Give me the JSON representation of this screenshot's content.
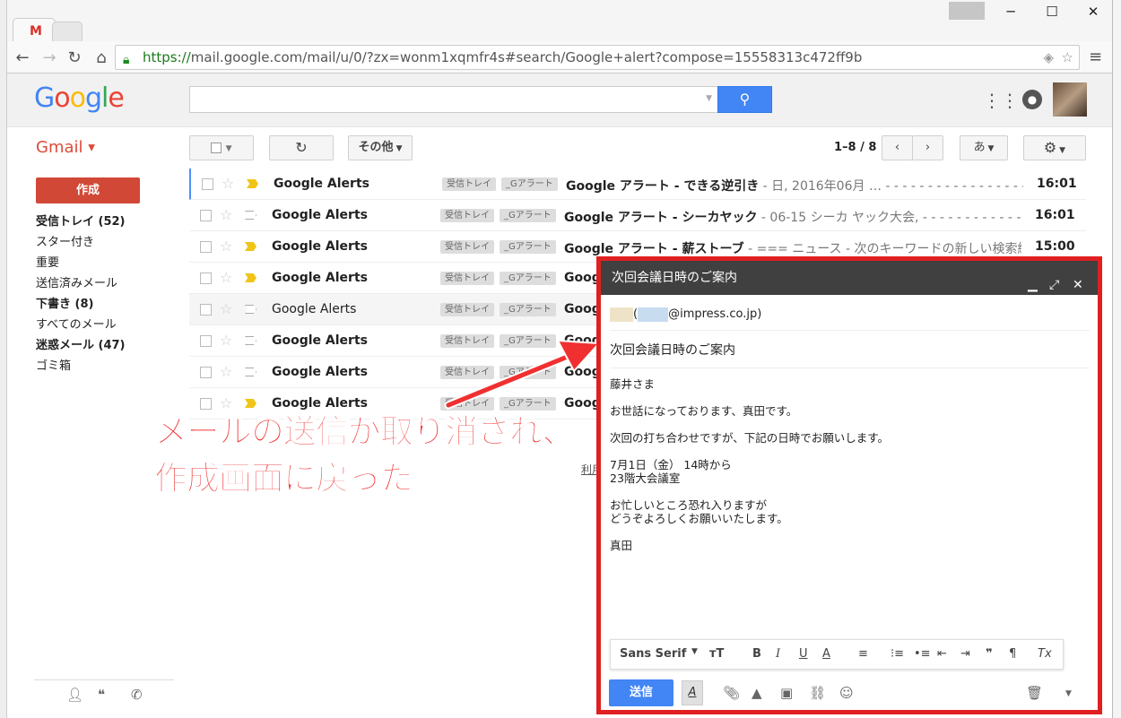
{
  "browser": {
    "tab_icon": "M",
    "url_scheme": "https://",
    "url_rest": "mail.google.com/mail/u/0/?zx=wonm1xqmfr4s#search/Google+alert?compose=15558313c472ff9b",
    "window_min": "─",
    "window_max": "☐",
    "window_close": "✕"
  },
  "header": {
    "logo_letters": [
      "G",
      "o",
      "o",
      "g",
      "l",
      "e"
    ],
    "logo_colors": [
      "#4285f4",
      "#ea4335",
      "#fbbc05",
      "#4285f4",
      "#34a853",
      "#ea4335"
    ],
    "search_placeholder": "",
    "search_icon": "search-icon"
  },
  "gmail": {
    "label": "Gmail",
    "compose_label": "作成",
    "more_label": "その他",
    "count_label": "1–8 / 8",
    "ime_label": "あ"
  },
  "nav": [
    {
      "label": "受信トレイ (52)",
      "bold": true
    },
    {
      "label": "スター付き",
      "bold": false
    },
    {
      "label": "重要",
      "bold": false
    },
    {
      "label": "送信済みメール",
      "bold": false
    },
    {
      "label": "下書き (8)",
      "bold": true
    },
    {
      "label": "すべてのメール",
      "bold": false
    },
    {
      "label": "迷惑メール (47)",
      "bold": true
    },
    {
      "label": "ゴミ箱",
      "bold": false
    }
  ],
  "emails": [
    {
      "sender": "Google Alerts",
      "label1": "受信トレイ",
      "label2": "_Gアラート",
      "subject": "Google アラート - できる逆引き",
      "snippet": " - 日, 2016年06月 … - - - - - - - - - - - - - - - - - -",
      "time": "16:01",
      "read": false,
      "important": true
    },
    {
      "sender": "Google Alerts",
      "label1": "受信トレイ",
      "label2": "_Gアラート",
      "subject": "Google アラート - シーカヤック",
      "snippet": " - 06-15 シーカ ヤック大会, - - - - - - - - - - - - - - -",
      "time": "16:01",
      "read": false,
      "important": false
    },
    {
      "sender": "Google Alerts",
      "label1": "受信トレイ",
      "label2": "_Gアラート",
      "subject": "Google アラート - 薪ストーブ",
      "snippet": " - === ニュース - 次のキーワードの新しい検索結果",
      "time": "15:00",
      "read": false,
      "important": true
    },
    {
      "sender": "Google Alerts",
      "label1": "受信トレイ",
      "label2": "_Gアラート",
      "subject": "Goog",
      "snippet": "",
      "time": "",
      "read": false,
      "important": true
    },
    {
      "sender": "Google Alerts",
      "label1": "受信トレイ",
      "label2": "_Gアラート",
      "subject": "Goog",
      "snippet": "",
      "time": "",
      "read": true,
      "important": false
    },
    {
      "sender": "Google Alerts",
      "label1": "受信トレイ",
      "label2": "_Gアラート",
      "subject": "Goog",
      "snippet": "",
      "time": "",
      "read": false,
      "important": false
    },
    {
      "sender": "Google Alerts",
      "label1": "受信トレイ",
      "label2": "_Gアラート",
      "subject": "Goog",
      "snippet": "",
      "time": "",
      "read": false,
      "important": false
    },
    {
      "sender": "Google Alerts",
      "label1": "受信トレイ",
      "label2": "_Gアラート",
      "subject": "Goog",
      "snippet": "",
      "time": "",
      "read": false,
      "important": true
    }
  ],
  "footer_link": "利用",
  "compose": {
    "title": "次回会議日時のご案内",
    "to_suffix": "@impress.co.jp)",
    "to_prefix": "(",
    "subject": "次回会議日時のご案内",
    "body": [
      "藤井さま",
      "お世話になっております、真田です。",
      "次回の打ち合わせですが、下記の日時でお願いします。",
      "7月1日（金） 14時から\n23階大会議室",
      "お忙しいところ恐れ入りますが\nどうぞよろしくお願いいたします。",
      "真田"
    ],
    "font_label": "Sans Serif",
    "send_label": "送信"
  },
  "callout": {
    "line1": "メールの送信が取り消され、",
    "line2": "作成画面に戻った",
    "color": "#f03030"
  }
}
